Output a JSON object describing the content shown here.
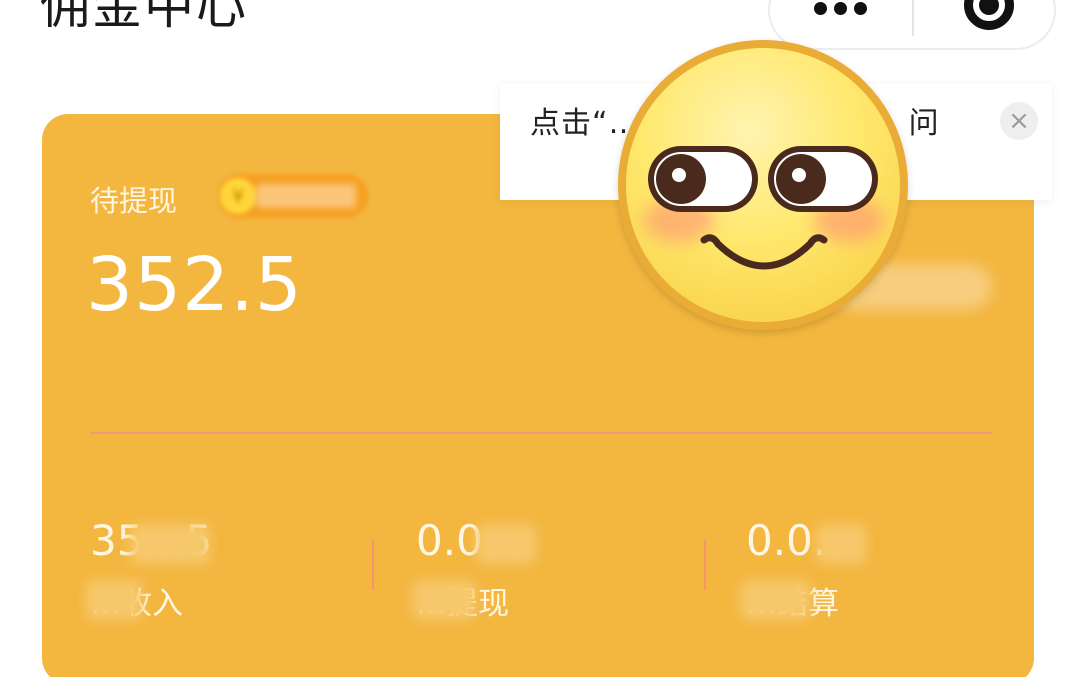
{
  "header": {
    "title": "佣金中心"
  },
  "tooltip": {
    "text": "点击“… 小程序，微信首… 问",
    "close_symbol": "×"
  },
  "card": {
    "pending_label": "待提现",
    "pending_amount": "352.5",
    "stats": [
      {
        "value": "35…5",
        "label": "…收入"
      },
      {
        "value": "0.0…",
        "label": "…提现"
      },
      {
        "value": "0.0…",
        "label": "…结算"
      }
    ]
  },
  "colors": {
    "card": "#f3b63f",
    "divider": "#f39a7e",
    "text_on_card": "#ffffff",
    "page_background": "#ffffff"
  },
  "icons": {
    "capsule_more": "more-dots-icon",
    "capsule_close": "circle-target-icon",
    "badge": "coin-icon",
    "overlay": "smiling-emoji-sticker"
  }
}
